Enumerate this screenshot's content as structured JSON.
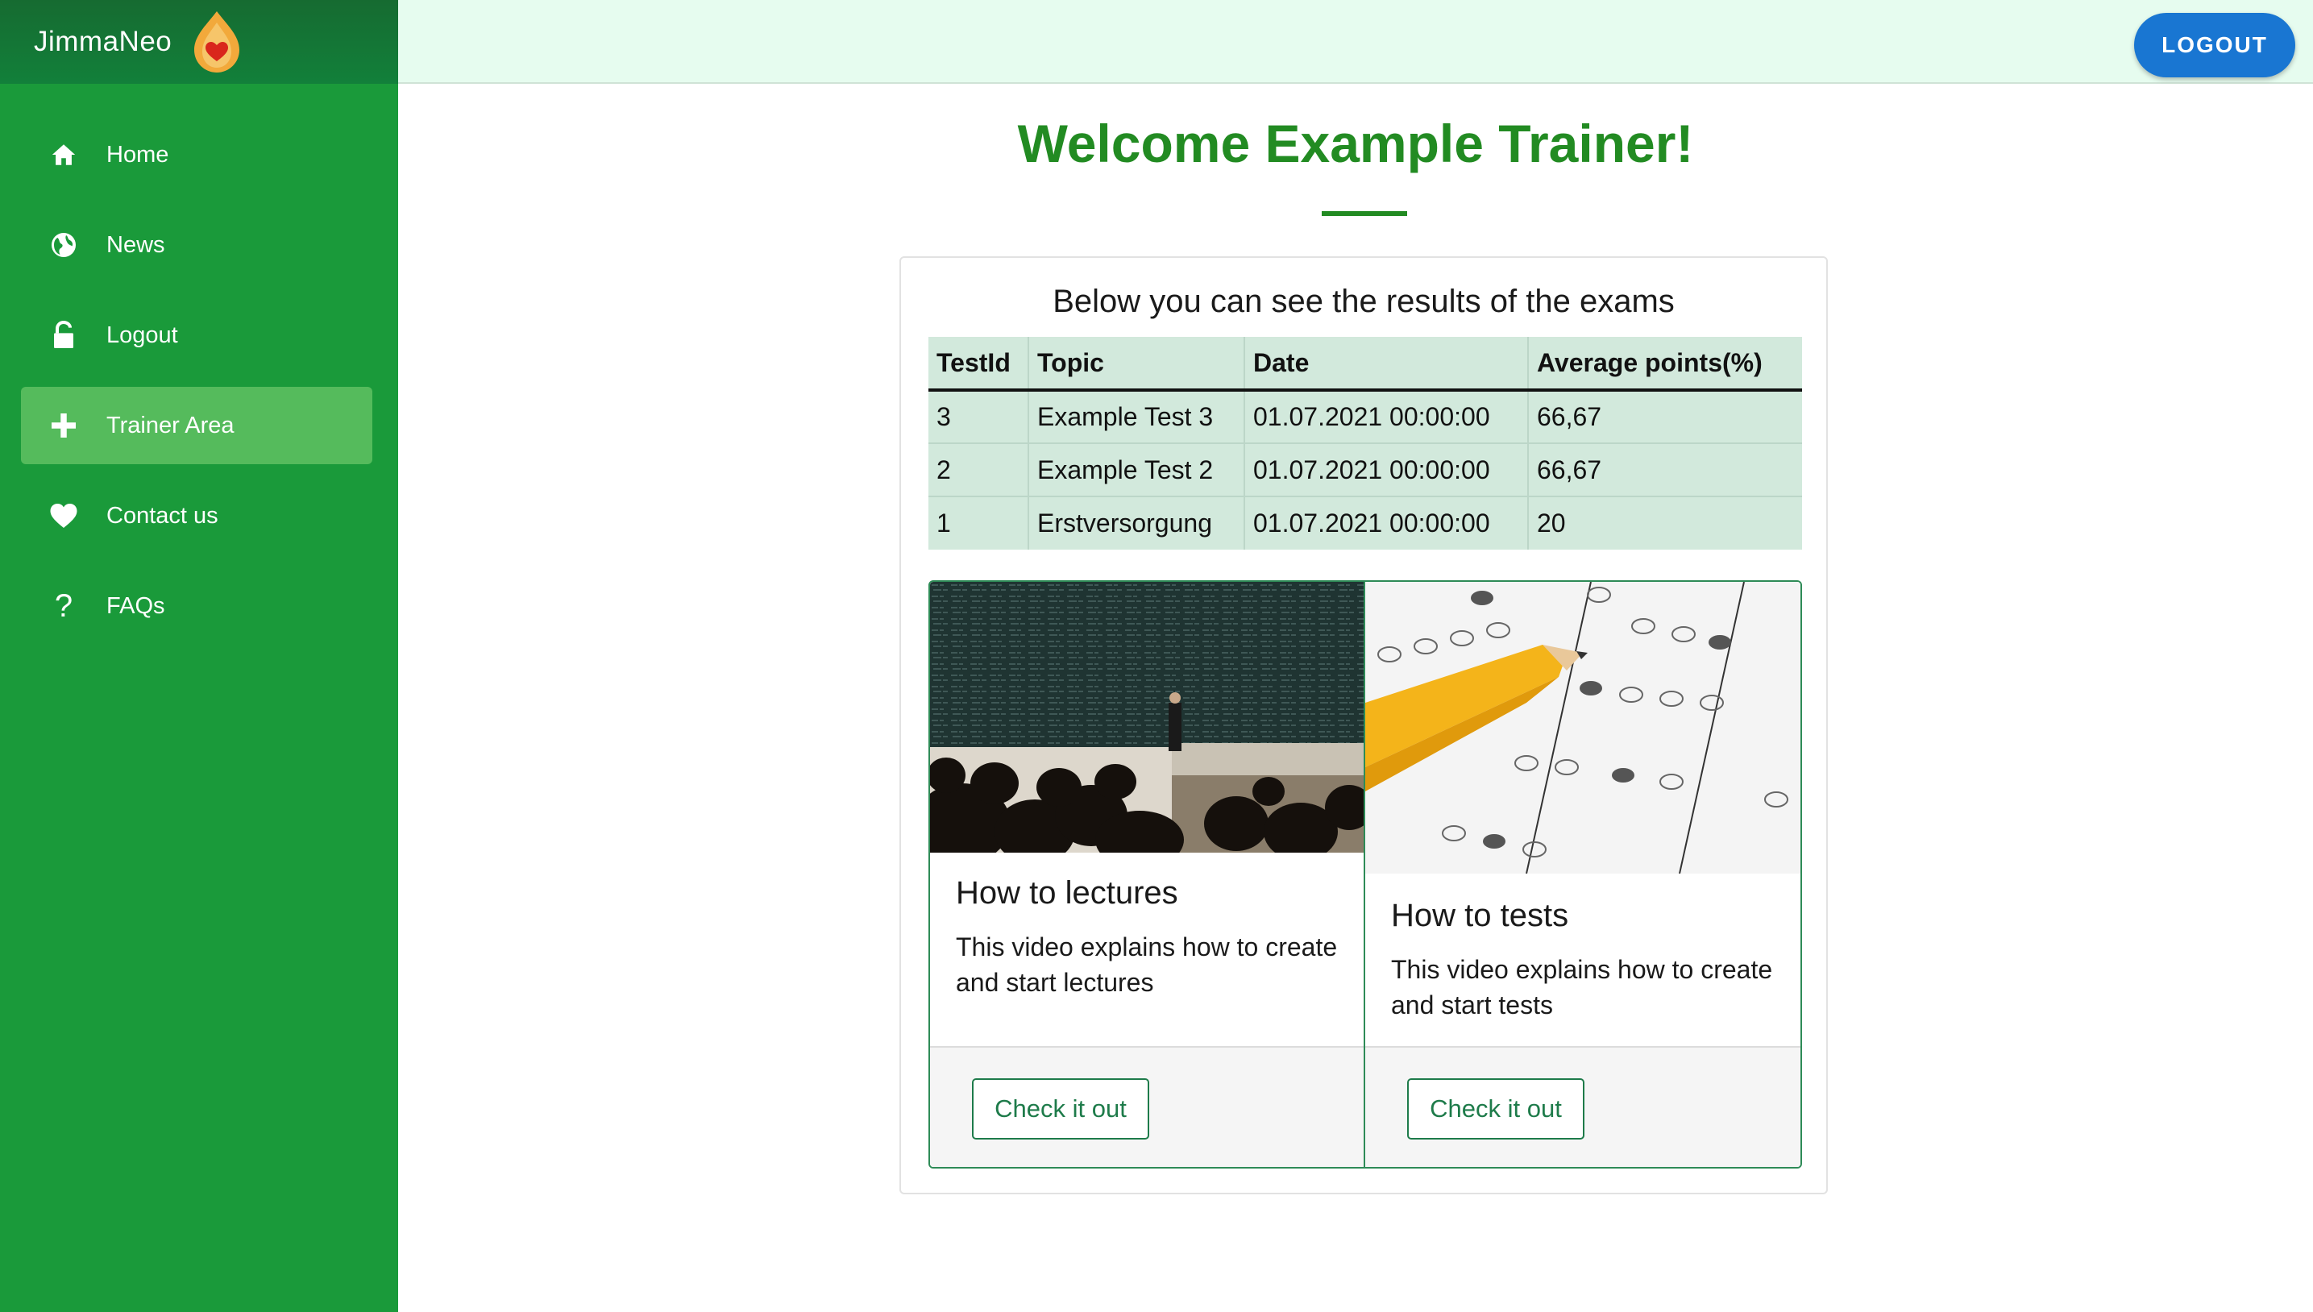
{
  "app": {
    "brand": "JimmaNeo"
  },
  "sidebar": {
    "items": [
      {
        "label": "Home",
        "icon": "home-icon",
        "active": false
      },
      {
        "label": "News",
        "icon": "globe-icon",
        "active": false
      },
      {
        "label": "Logout",
        "icon": "lock-icon",
        "active": false
      },
      {
        "label": "Trainer Area",
        "icon": "plus-icon",
        "active": true
      },
      {
        "label": "Contact us",
        "icon": "heart-icon",
        "active": false
      },
      {
        "label": "FAQs",
        "icon": "question-icon",
        "active": false
      }
    ]
  },
  "topbar": {
    "logout_label": "LOGOUT"
  },
  "main": {
    "welcome": "Welcome Example Trainer!",
    "caption": "Below you can see the results of the exams",
    "table": {
      "headers": [
        "TestId",
        "Topic",
        "Date",
        "Average points(%)"
      ],
      "rows": [
        [
          "3",
          "Example Test 3",
          "01.07.2021 00:00:00",
          "66,67"
        ],
        [
          "2",
          "Example Test 2",
          "01.07.2021 00:00:00",
          "66,67"
        ],
        [
          "1",
          "Erstversorgung",
          "01.07.2021 00:00:00",
          "20"
        ]
      ]
    },
    "cards": [
      {
        "title": "How to lectures",
        "text": "This video explains how to create and start lectures",
        "button": "Check it out",
        "image": "lecture-hall-image"
      },
      {
        "title": "How to tests",
        "text": "This video explains how to create and start tests",
        "button": "Check it out",
        "image": "answer-sheet-image"
      }
    ]
  },
  "colors": {
    "sidebar": "#1a9a3a",
    "accent": "#228b22",
    "topbar": "#e6fcef",
    "logout": "#1976d2",
    "table": "#d2e9dc"
  }
}
